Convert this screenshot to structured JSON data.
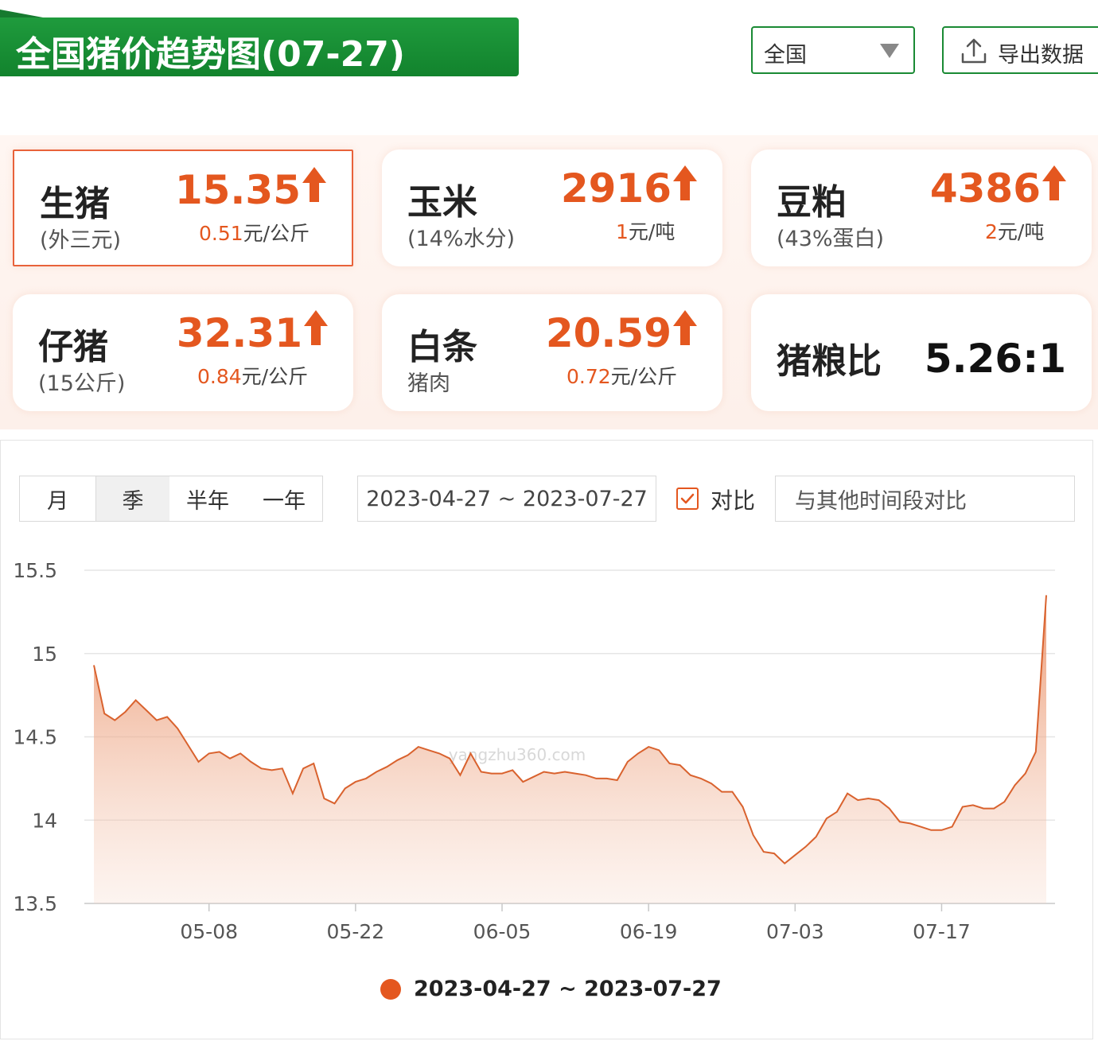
{
  "header": {
    "title": "全国猪价趋势图(07-27)",
    "region": "全国",
    "export_label": "导出数据"
  },
  "cards": [
    {
      "name": "生猪",
      "sub": "(外三元)",
      "price": "15.35",
      "change": "0.51",
      "unit": "元/公斤",
      "trend": "up",
      "selected": true
    },
    {
      "name": "玉米",
      "sub": "(14%水分)",
      "price": "2916",
      "change": "1",
      "unit": "元/吨",
      "trend": "up"
    },
    {
      "name": "豆粕",
      "sub": "(43%蛋白)",
      "price": "4386",
      "change": "2",
      "unit": "元/吨",
      "trend": "up"
    },
    {
      "name": "仔猪",
      "sub": "(15公斤)",
      "price": "32.31",
      "change": "0.84",
      "unit": "元/公斤",
      "trend": "up"
    },
    {
      "name": "白条",
      "sub": "猪肉",
      "price": "20.59",
      "change": "0.72",
      "unit": "元/公斤",
      "trend": "up"
    },
    {
      "name": "猪粮比",
      "value": "5.26:1"
    }
  ],
  "controls": {
    "periods": [
      "月",
      "季",
      "半年",
      "一年"
    ],
    "selected_period": "季",
    "date_range": "2023-04-27 ~ 2023-07-27",
    "compare_checked": true,
    "compare_label": "对比",
    "compare_placeholder": "与其他时间段对比"
  },
  "colors": {
    "brand_green": "#1a8a34",
    "accent_orange": "#e4571f",
    "line": "#d9622e"
  },
  "watermark": {
    "text": "yangzhu360.com"
  },
  "chart_data": {
    "type": "area",
    "title": "",
    "xlabel": "",
    "ylabel": "",
    "ylim": [
      13.5,
      15.5
    ],
    "yticks": [
      "15.5",
      "15",
      "14.5",
      "14",
      "13.5"
    ],
    "xticks": [
      "05-08",
      "05-22",
      "06-05",
      "06-19",
      "07-03",
      "07-17"
    ],
    "legend": "bottom-center",
    "grid": true,
    "series": [
      {
        "name": "2023-04-27 ~ 2023-07-27",
        "x": [
          "04-27",
          "04-28",
          "04-29",
          "04-30",
          "05-01",
          "05-02",
          "05-03",
          "05-04",
          "05-05",
          "05-06",
          "05-07",
          "05-08",
          "05-09",
          "05-10",
          "05-11",
          "05-12",
          "05-13",
          "05-14",
          "05-15",
          "05-16",
          "05-17",
          "05-18",
          "05-19",
          "05-20",
          "05-21",
          "05-22",
          "05-23",
          "05-24",
          "05-25",
          "05-26",
          "05-27",
          "05-28",
          "05-29",
          "05-30",
          "05-31",
          "06-01",
          "06-02",
          "06-03",
          "06-04",
          "06-05",
          "06-06",
          "06-07",
          "06-08",
          "06-09",
          "06-10",
          "06-11",
          "06-12",
          "06-13",
          "06-14",
          "06-15",
          "06-16",
          "06-17",
          "06-18",
          "06-19",
          "06-20",
          "06-21",
          "06-22",
          "06-23",
          "06-24",
          "06-25",
          "06-26",
          "06-27",
          "06-28",
          "06-29",
          "06-30",
          "07-01",
          "07-02",
          "07-03",
          "07-04",
          "07-05",
          "07-06",
          "07-07",
          "07-08",
          "07-09",
          "07-10",
          "07-11",
          "07-12",
          "07-13",
          "07-14",
          "07-15",
          "07-16",
          "07-17",
          "07-18",
          "07-19",
          "07-20",
          "07-21",
          "07-22",
          "07-23",
          "07-24",
          "07-25",
          "07-26",
          "07-27"
        ],
        "values": [
          14.93,
          14.64,
          14.6,
          14.65,
          14.72,
          14.66,
          14.6,
          14.62,
          14.55,
          14.45,
          14.35,
          14.4,
          14.41,
          14.37,
          14.4,
          14.35,
          14.31,
          14.3,
          14.31,
          14.16,
          14.31,
          14.34,
          14.13,
          14.1,
          14.19,
          14.23,
          14.25,
          14.29,
          14.32,
          14.36,
          14.39,
          14.44,
          14.42,
          14.4,
          14.37,
          14.27,
          14.4,
          14.29,
          14.28,
          14.28,
          14.3,
          14.23,
          14.26,
          14.29,
          14.28,
          14.29,
          14.28,
          14.27,
          14.25,
          14.25,
          14.24,
          14.35,
          14.4,
          14.44,
          14.42,
          14.34,
          14.33,
          14.27,
          14.25,
          14.22,
          14.17,
          14.17,
          14.08,
          13.91,
          13.81,
          13.8,
          13.74,
          13.79,
          13.84,
          13.9,
          14.01,
          14.05,
          14.16,
          14.12,
          14.13,
          14.12,
          14.07,
          13.99,
          13.98,
          13.96,
          13.94,
          13.94,
          13.96,
          14.08,
          14.09,
          14.07,
          14.07,
          14.11,
          14.21,
          14.28,
          14.41,
          15.35
        ]
      }
    ]
  }
}
